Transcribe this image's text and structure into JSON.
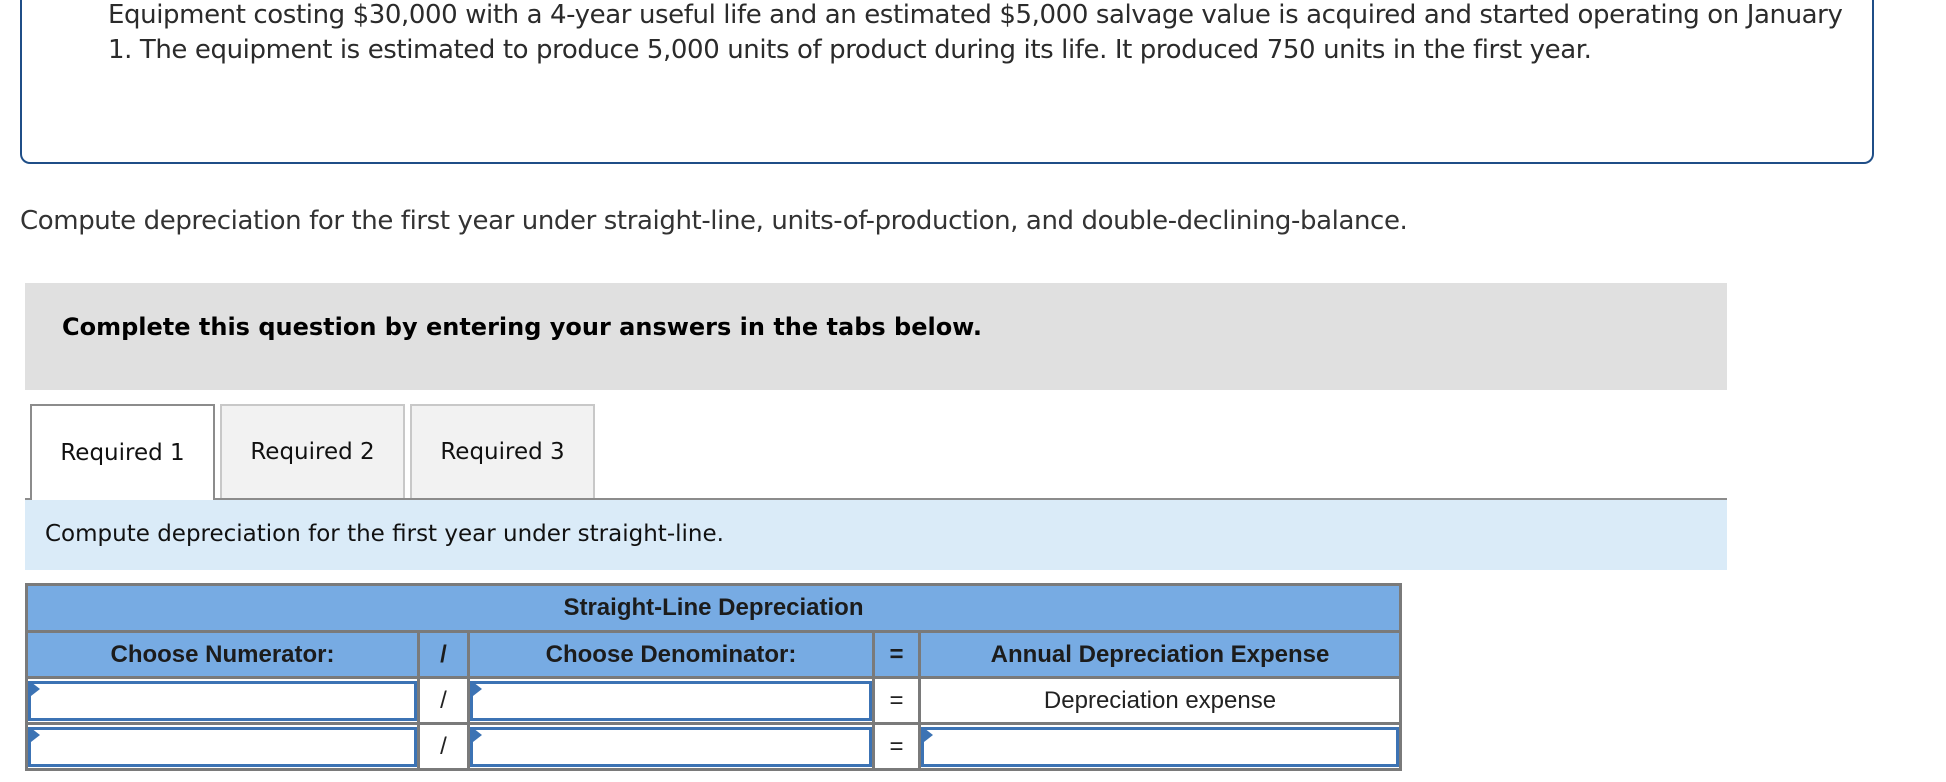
{
  "problem": {
    "text": "Equipment costing $30,000 with a 4-year useful life and an estimated $5,000 salvage value is acquired and started operating on January 1. The equipment is estimated to produce 5,000 units of product during its life. It produced 750 units in the first year."
  },
  "instruction": "Compute depreciation for the first year under straight-line, units-of-production, and double-declining-balance.",
  "notice": "Complete this question by entering your answers in the tabs below.",
  "tabs": [
    {
      "label": "Required 1",
      "active": true
    },
    {
      "label": "Required 2",
      "active": false
    },
    {
      "label": "Required 3",
      "active": false
    }
  ],
  "subtask": "Compute depreciation for the first year under straight-line.",
  "table": {
    "title": "Straight-Line Depreciation",
    "headers": {
      "numerator": "Choose Numerator:",
      "divide": "/",
      "denominator": "Choose Denominator:",
      "equals": "=",
      "result": "Annual Depreciation Expense"
    },
    "rows": [
      {
        "numerator": "",
        "op": "/",
        "denominator": "",
        "eq": "=",
        "result": "Depreciation expense",
        "result_is_label": true
      },
      {
        "numerator": "",
        "op": "/",
        "denominator": "",
        "eq": "=",
        "result": "",
        "result_is_label": false
      }
    ]
  },
  "colors": {
    "box_border": "#1f4e87",
    "notice_bg": "#e0e0e0",
    "subtask_bg": "#daebf8",
    "header_bg": "#77abe3",
    "input_border": "#3c73b4"
  }
}
